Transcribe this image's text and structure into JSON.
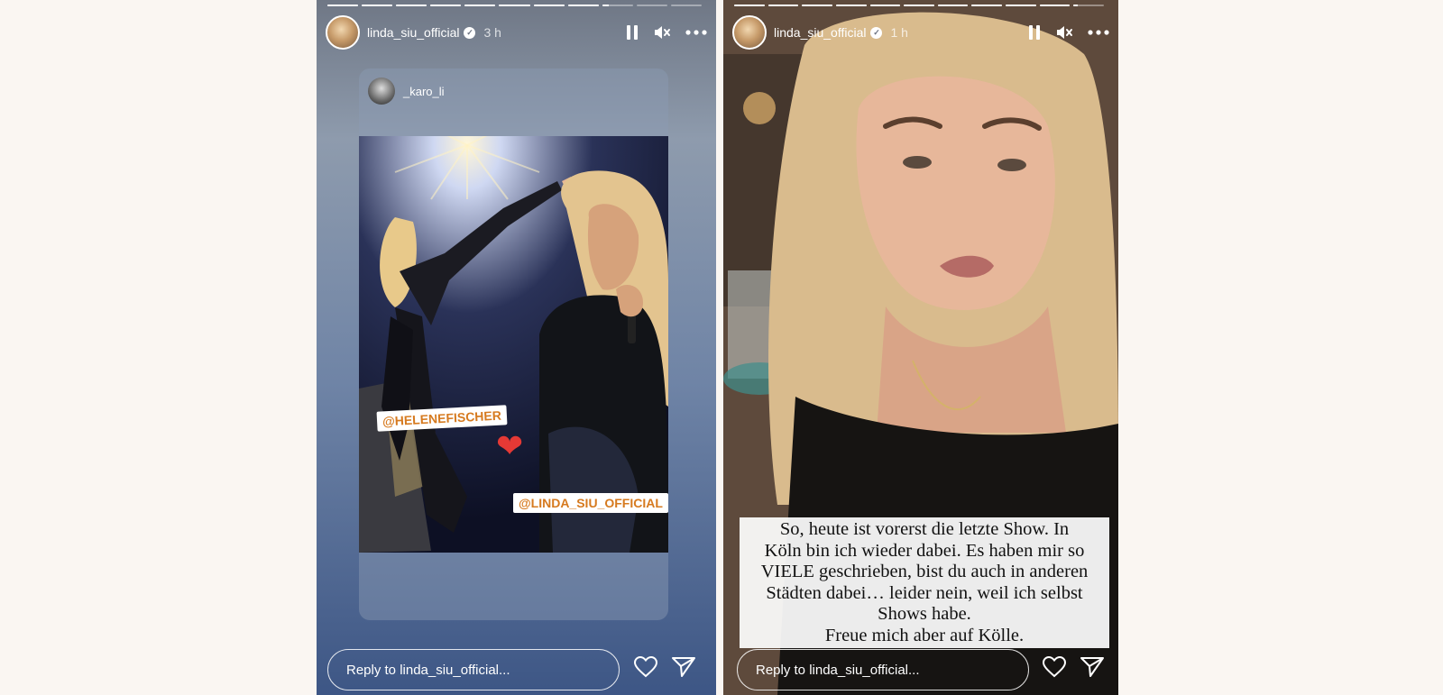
{
  "story_left": {
    "username": "linda_siu_official",
    "time": "3 h",
    "progress_segments": 11,
    "progress_active_index": 8,
    "shared_post": {
      "username": "_karo_li",
      "tags": [
        "@HELENEFISCHER",
        "@LINDA_SIU_OFFICIAL"
      ]
    },
    "reply_placeholder": "Reply to linda_siu_official..."
  },
  "story_right": {
    "username": "linda_siu_official",
    "time": "1 h",
    "progress_segments": 11,
    "progress_active_index": 10,
    "caption_lines": [
      "So, heute ist vorerst die letzte Show. In",
      "Köln bin ich wieder dabei. Es haben mir so",
      "VIELE geschrieben, bist du auch in anderen",
      "Städten dabei… leider nein, weil ich selbst",
      "Shows habe.",
      "Freue mich aber auf Kölle."
    ],
    "reply_placeholder": "Reply to linda_siu_official..."
  },
  "icons": {
    "pause": "pause-icon",
    "mute": "muted-speaker-icon",
    "more": "more-horizontal-icon",
    "like": "heart-outline-icon",
    "share": "paper-plane-icon",
    "verified": "verified-badge-icon"
  },
  "colors": {
    "page_background": "#faf6f2",
    "tag_text": "#d67a1f",
    "heart_sticker": "#e53935"
  }
}
